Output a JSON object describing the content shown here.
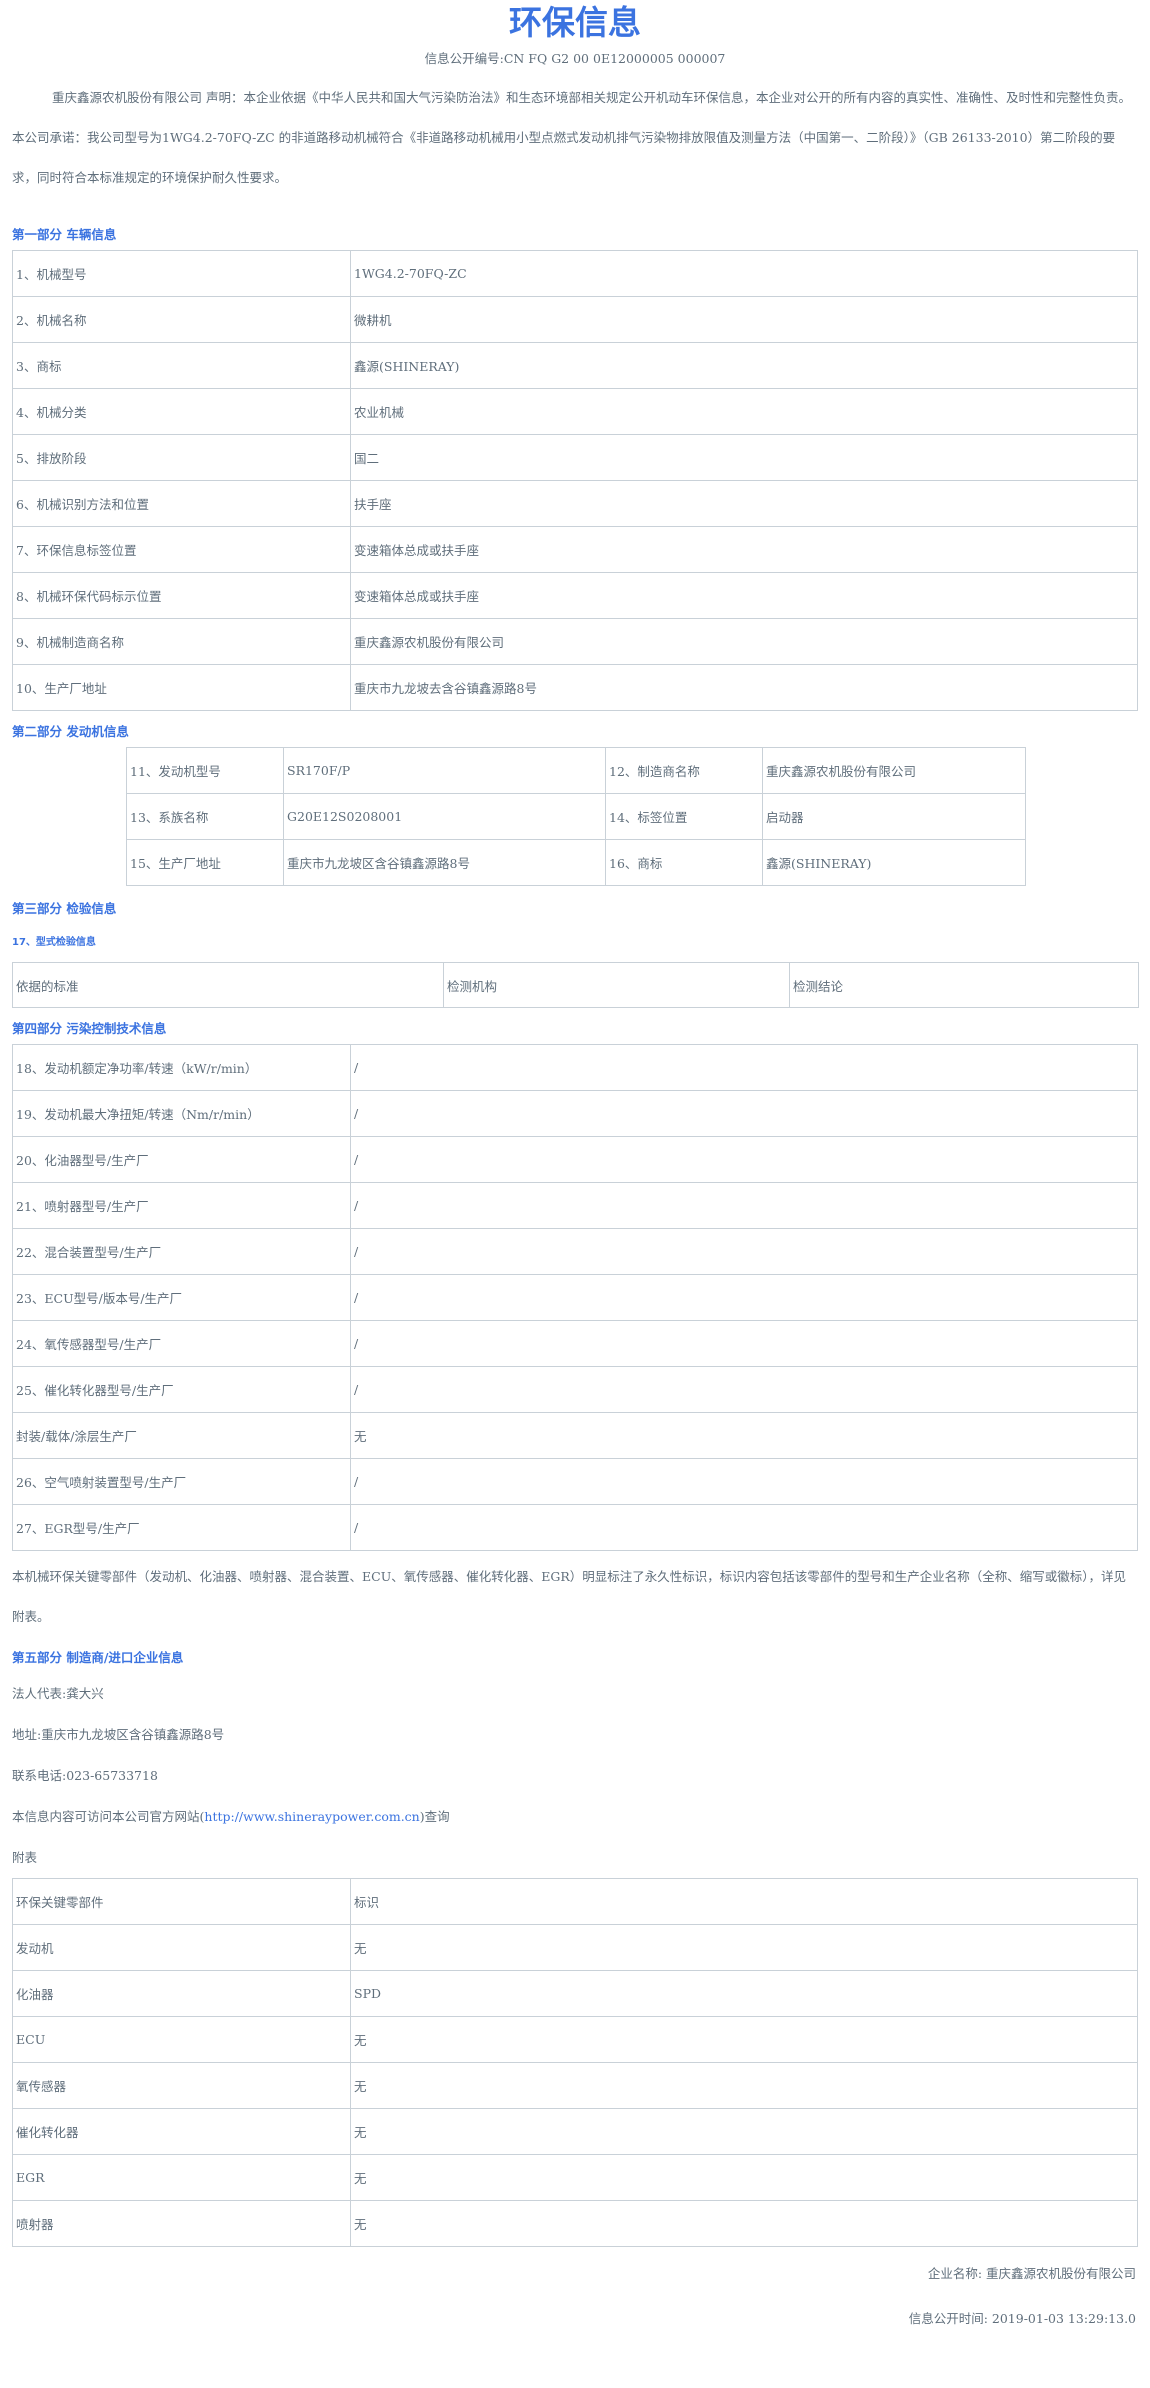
{
  "title": "环保信息",
  "info_no_label": "信息公开编号:",
  "info_no": "CN FQ G2 00 0E12000005 000007",
  "intro": "重庆鑫源农机股份有限公司 声明：本企业依据《中华人民共和国大气污染防治法》和生态环境部相关规定公开机动车环保信息，本企业对公开的所有内容的真实性、准确性、及时性和完整性负责。本公司承诺：我公司型号为1WG4.2-70FQ-ZC 的非道路移动机械符合《非道路移动机械用小型点燃式发动机排气污染物排放限值及测量方法（中国第一、二阶段）》（GB 26133-2010）第二阶段的要求，同时符合本标准规定的环境保护耐久性要求。",
  "part1": {
    "heading": "第一部分 车辆信息",
    "rows": [
      [
        "1、机械型号",
        "1WG4.2-70FQ-ZC"
      ],
      [
        "2、机械名称",
        "微耕机"
      ],
      [
        "3、商标",
        "鑫源(SHINERAY)"
      ],
      [
        "4、机械分类",
        "农业机械"
      ],
      [
        "5、排放阶段",
        "国二"
      ],
      [
        "6、机械识别方法和位置",
        "扶手座"
      ],
      [
        "7、环保信息标签位置",
        "变速箱体总成或扶手座"
      ],
      [
        "8、机械环保代码标示位置",
        "变速箱体总成或扶手座"
      ],
      [
        "9、机械制造商名称",
        "重庆鑫源农机股份有限公司"
      ],
      [
        "10、生产厂地址",
        "重庆市九龙坡去含谷镇鑫源路8号"
      ]
    ]
  },
  "part2": {
    "heading": "第二部分 发动机信息",
    "rows": [
      [
        "11、发动机型号",
        "SR170F/P",
        "12、制造商名称",
        "重庆鑫源农机股份有限公司"
      ],
      [
        "13、系族名称",
        "G20E12S0208001",
        "14、标签位置",
        "启动器"
      ],
      [
        "15、生产厂地址",
        "重庆市九龙坡区含谷镇鑫源路8号",
        "16、商标",
        "鑫源(SHINERAY)"
      ]
    ]
  },
  "part3": {
    "heading": "第三部分  检验信息",
    "sub_heading": "17、型式检验信息",
    "headers": [
      "依据的标准",
      "检测机构",
      "检测结论"
    ]
  },
  "part4": {
    "heading": "第四部分 污染控制技术信息",
    "rows": [
      [
        "18、发动机额定净功率/转速（kW/r/min）",
        "/"
      ],
      [
        "19、发动机最大净扭矩/转速（Nm/r/min）",
        "/"
      ],
      [
        "20、化油器型号/生产厂",
        "/"
      ],
      [
        "21、喷射器型号/生产厂",
        "/"
      ],
      [
        "22、混合装置型号/生产厂",
        "/"
      ],
      [
        "23、ECU型号/版本号/生产厂",
        "/"
      ],
      [
        "24、氧传感器型号/生产厂",
        "/"
      ],
      [
        "25、催化转化器型号/生产厂",
        "/"
      ],
      [
        "封装/载体/涂层生产厂",
        "无"
      ],
      [
        "26、空气喷射装置型号/生产厂",
        "/"
      ],
      [
        "27、EGR型号/生产厂",
        "/"
      ]
    ],
    "note": "本机械环保关键零部件（发动机、化油器、喷射器、混合装置、ECU、氧传感器、催化转化器、EGR）明显标注了永久性标识，标识内容包括该零部件的型号和生产企业名称（全称、缩写或徽标），详见附表。"
  },
  "part5": {
    "heading": "第五部分 制造商/进口企业信息",
    "legal_rep": "法人代表:龚大兴",
    "address": "地址:重庆市九龙坡区含谷镇鑫源路8号",
    "phone": "联系电话:023-65733718",
    "site_prefix": "本信息内容可访问本公司官方网站(",
    "site_url": "http://www.shineraypower.com.cn",
    "site_suffix": ")查询",
    "appendix_label": "附表"
  },
  "appendix": {
    "headers": [
      "环保关键零部件",
      "标识"
    ],
    "rows": [
      [
        "发动机",
        "无"
      ],
      [
        "化油器",
        "SPD"
      ],
      [
        "ECU",
        "无"
      ],
      [
        "氧传感器",
        "无"
      ],
      [
        "催化转化器",
        "无"
      ],
      [
        "EGR",
        "无"
      ],
      [
        "喷射器",
        "无"
      ]
    ]
  },
  "footer": {
    "company": "企业名称: 重庆鑫源农机股份有限公司",
    "time": "信息公开时间: 2019-01-03 13:29:13.0"
  },
  "colors": {
    "accent": "#3b73e0",
    "text": "#5f6e7b",
    "border": "#c9d1d8"
  }
}
